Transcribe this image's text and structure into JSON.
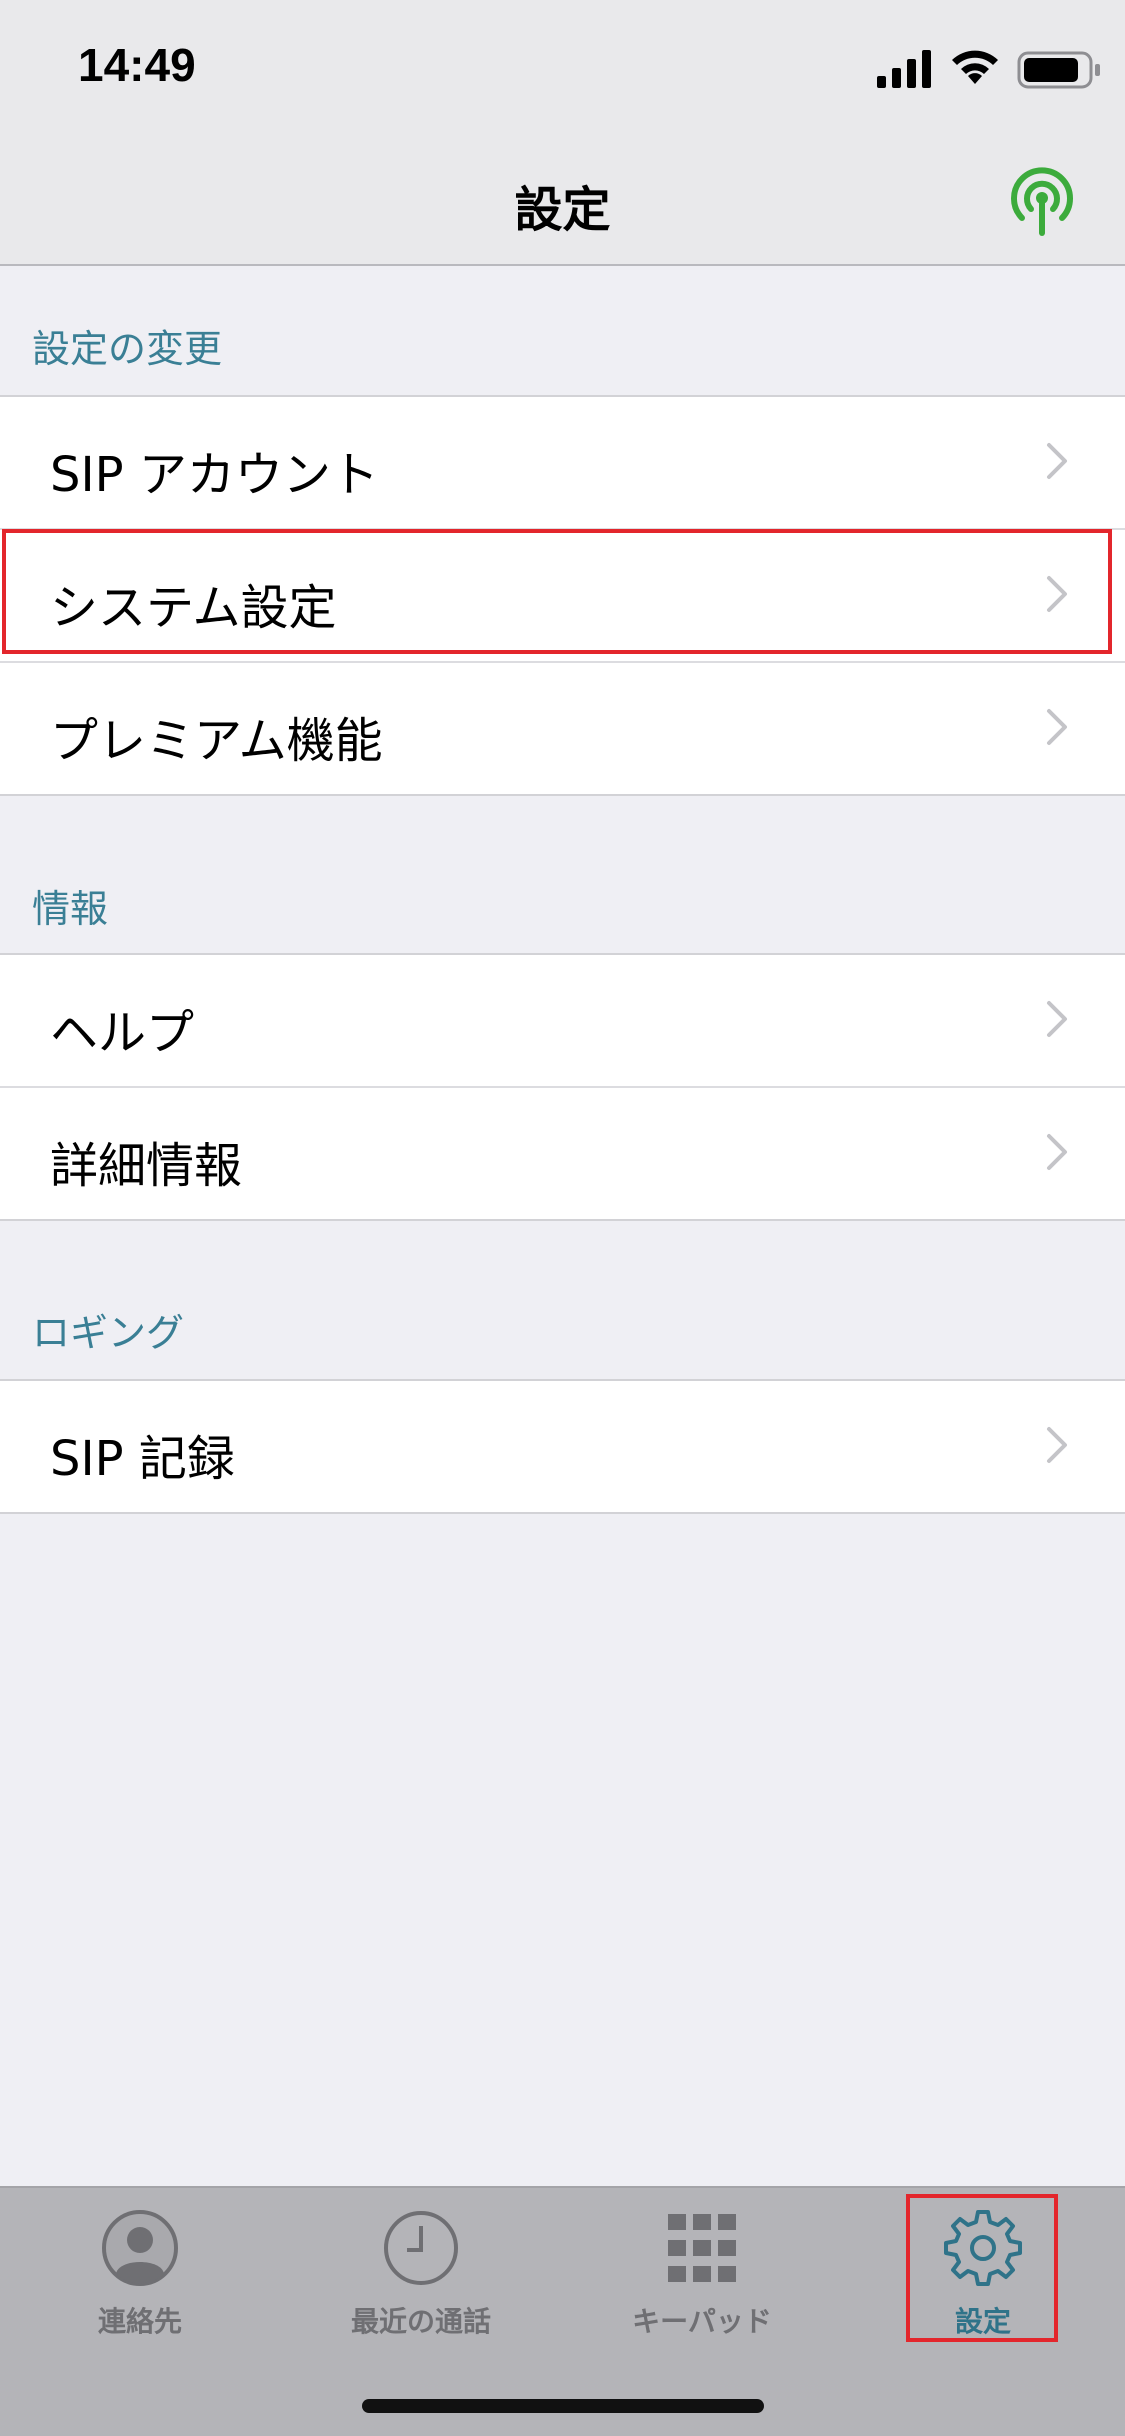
{
  "status_bar": {
    "time": "14:49"
  },
  "nav": {
    "title": "設定"
  },
  "sections": [
    {
      "header": "設定の変更",
      "items": [
        {
          "label": "SIP アカウント"
        },
        {
          "label": "システム設定"
        },
        {
          "label": "プレミアム機能"
        }
      ]
    },
    {
      "header": "情報",
      "items": [
        {
          "label": "ヘルプ"
        },
        {
          "label": "詳細情報"
        }
      ]
    },
    {
      "header": "ロギング",
      "items": [
        {
          "label": "SIP 記録"
        }
      ]
    }
  ],
  "tabs": [
    {
      "label": "連絡先",
      "icon": "contact-icon"
    },
    {
      "label": "最近の通話",
      "icon": "clock-icon"
    },
    {
      "label": "キーパッド",
      "icon": "keypad-icon"
    },
    {
      "label": "設定",
      "icon": "gear-icon",
      "active": true
    }
  ],
  "colors": {
    "accent": "#2f7389",
    "section_header": "#3a7f95",
    "highlight": "#e3262c",
    "broadcast": "#3cab3c"
  }
}
